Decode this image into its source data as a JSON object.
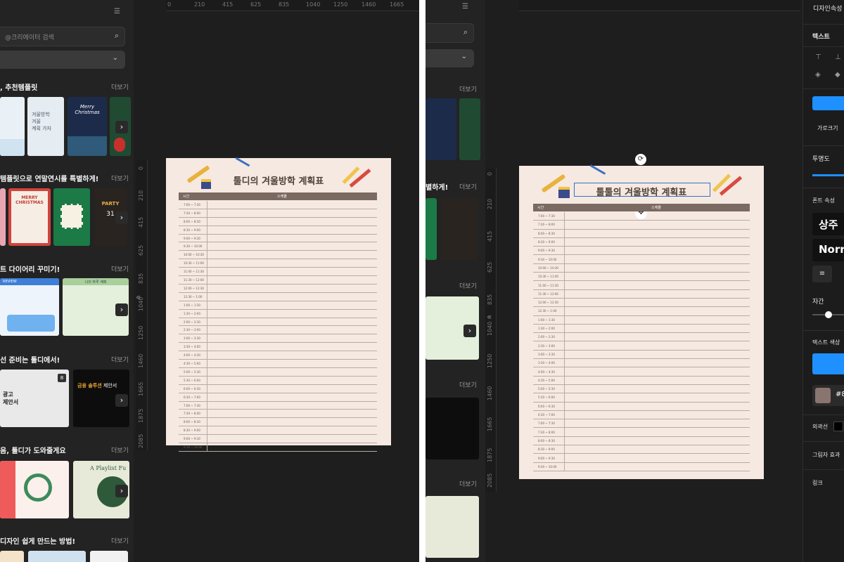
{
  "left": {
    "search_placeholder": "@크리에이터 검색",
    "more_label": "더보기",
    "sections": [
      {
        "title": ", 추천템플릿"
      },
      {
        "title": "템플릿으로 연말연시를 특별하게!"
      },
      {
        "title": "트 다이어리 꾸미기!"
      },
      {
        "title": "선 준비는 툴디에서!"
      },
      {
        "title": "음, 툴디가 도와줄게요"
      },
      {
        "title": "디자인 쉽게 만드는 방법!"
      }
    ],
    "thumbs": {
      "christmas": "Merry Christmas",
      "plan_lines": [
        "겨울방학",
        "겨울",
        "계획 가자"
      ],
      "merry_christmas": "MERRY CHRISTMAS",
      "party": "PARTY",
      "party_num": "31",
      "review": "REVIEW",
      "diary": "나의 하루 계획",
      "proposal_prefix": "금융 솔루션",
      "proposal_suffix": "제안서",
      "ad_lines": [
        "광고",
        "제안서"
      ],
      "badge": "8",
      "playlist": "A Playlist Fu"
    },
    "ruler_h": [
      "0",
      "210",
      "415",
      "625",
      "835",
      "1040",
      "1250",
      "1460",
      "1665"
    ],
    "ruler_v": [
      "0",
      "210",
      "415",
      "625",
      "835",
      "1040",
      "1250",
      "1460",
      "1665",
      "1875",
      "2085"
    ],
    "doc": {
      "title": "툴디의 겨울방학 계획표",
      "col_time": "시간",
      "col_schedule": "스케쥴"
    }
  },
  "right": {
    "more_label": "더보기",
    "sections": [
      {
        "title": "별하게!"
      }
    ],
    "ruler_v": [
      "0",
      "210",
      "415",
      "625",
      "835",
      "1040",
      "1250",
      "1460",
      "1665",
      "1875",
      "2085"
    ],
    "doc": {
      "title": "툴툴의 겨울방학 계획표",
      "col_time": "시간",
      "col_schedule": "스케쥴"
    },
    "panel": {
      "tabs": "디자인속성",
      "text_header": "텍스트",
      "width_label": "가로크기",
      "opacity_label": "투명도",
      "font_props": "폰트 속성",
      "font_name": "상주",
      "font_weight": "Norr",
      "spacing_label": "자간",
      "text_color_label": "텍스트 색상",
      "color_hex": "#8",
      "outline_label": "외곽선",
      "shadow_label": "그림자 효과",
      "link_label": "링크"
    }
  },
  "times": [
    "7:00 ~ 7:30",
    "7:30 ~ 8:00",
    "8:00 ~ 8:30",
    "8:30 ~ 9:00",
    "9:00 ~ 9:30",
    "9:30 ~ 10:00",
    "10:00 ~ 10:30",
    "10:30 ~ 11:00",
    "11:00 ~ 11:30",
    "11:30 ~ 12:00",
    "12:00 ~ 12:30",
    "12:30 ~ 1:00",
    "1:00 ~ 1:30",
    "1:30 ~ 2:00",
    "2:00 ~ 2:30",
    "2:30 ~ 3:00",
    "3:00 ~ 3:30",
    "3:30 ~ 4:00",
    "4:00 ~ 4:30",
    "4:30 ~ 5:00",
    "5:00 ~ 5:30",
    "5:30 ~ 6:00",
    "6:00 ~ 6:30",
    "6:30 ~ 7:00",
    "7:00 ~ 7:30",
    "7:30 ~ 8:00",
    "8:00 ~ 8:30",
    "8:30 ~ 9:00",
    "9:00 ~ 9:30",
    "9:30 ~ 10:00"
  ],
  "colors": {
    "accent": "#1e90ff",
    "page_bg": "#f5e9e1",
    "header_bar": "#7a6a61",
    "app_bg": "#1e1e1e"
  },
  "icons": [
    "search-icon",
    "filter-icon",
    "chevron-down-icon",
    "chevron-right-icon",
    "collapse-left-icon",
    "rotate-icon",
    "move-icon",
    "align-left-icon",
    "pencil-icon",
    "crayon-icon"
  ]
}
